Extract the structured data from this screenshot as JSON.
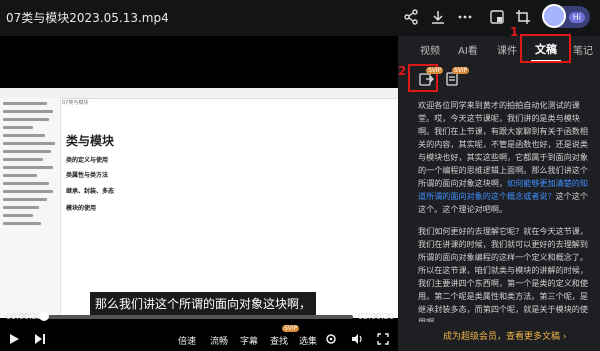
{
  "window": {
    "title": "07类与模块2023.05.13.mp4"
  },
  "toolbar_icons": [
    "share-icon",
    "download-icon",
    "more-icon",
    "pip-icon",
    "crop-icon"
  ],
  "avatar": {
    "badge": "Hi"
  },
  "video": {
    "subtitle": "那么我们讲这个所谓的面向对象这块啊，",
    "time_current": "00:00:22",
    "time_total": "02:00:20",
    "progress": 0.003,
    "frame": {
      "tab_hint": "07类与模块",
      "heading": "类与模块",
      "subs": [
        "类的定义与使用",
        "类属性与类方法",
        "继承、封装、多态",
        "模块的使用"
      ]
    },
    "controls": {
      "speed": "倍速",
      "fluency": "流畅",
      "caption": "字幕",
      "find": "查找",
      "episodes": "选集",
      "svip": "SVIP"
    }
  },
  "panel": {
    "tabs": [
      "视频",
      "AI看",
      "课件",
      "文稿",
      "笔记"
    ],
    "active_tab": "文稿",
    "annotations": {
      "one": "1",
      "two": "2"
    },
    "tool_badges": {
      "first": "SVIP",
      "second": "SVIP"
    },
    "doc": {
      "p1_a": "欢迎各位同学来到黄才的拍拍自动化测试的课堂。哎，今天这节课呢，我们讲的是类与模块啊。我们在上节课，有跟大家聊到有关于函数相关的内容，其实呢，不管是函数也好，还是说类与模块也好，其实这些啊，它都属于到面向对象的一个编程的思维逻辑上面啊。那么我们讲这个所谓的面向对象这块啊，",
      "p1_hl": "如何能够更加清楚的知道所谓的面向对象的这个概念或者说？",
      "p1_b": "这个这个这个。这个理论对吧啊。",
      "p2": "我们如何更好的去理解它呢？就在今天这节课，我们在讲课的时候，我们就可以更好的去理解到所谓的面向对象编程的这样一个定义和概念了。所以在这节课，咱们就类与模块的讲解的时候，我们主要讲四个东西啊，第一个是类的定义和使用。第二个呢是类属性和类方法。第三个呢，是继承封装多态，而第四个呢，就是关于模块的使用啊。"
    },
    "footer_link": "成为超级会员，查看更多文稿 ›"
  },
  "colors": {
    "accent_red": "#e01818",
    "link_blue": "#3f8fff",
    "vip_gold": "#f2b64a"
  }
}
